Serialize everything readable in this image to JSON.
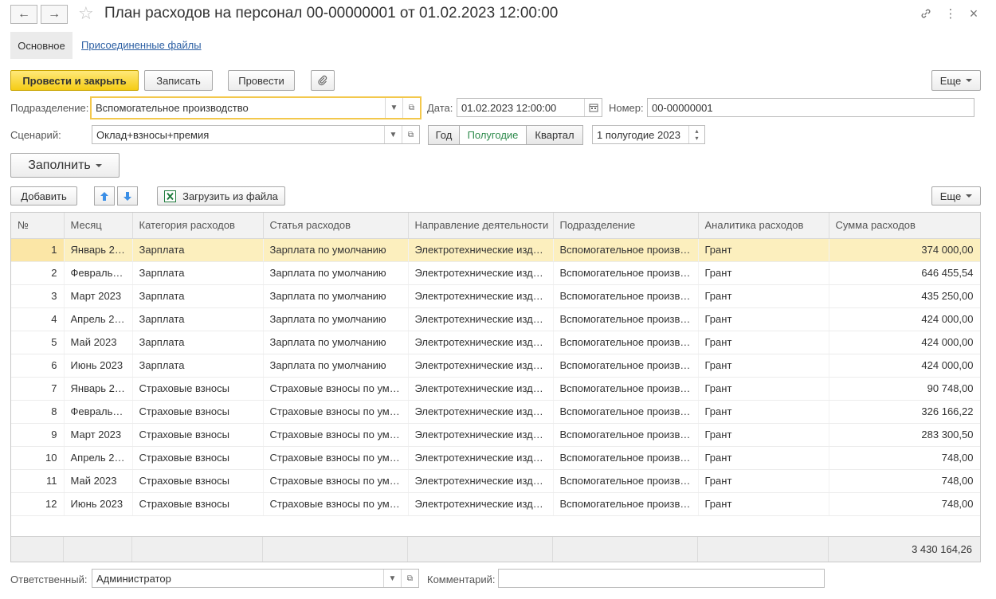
{
  "window": {
    "title": "План расходов на персонал 00-00000001 от 01.02.2023 12:00:00",
    "back_glyph": "←",
    "forward_glyph": "→",
    "star_glyph": "☆",
    "link_glyph": "🔗",
    "more_glyph": "⋮",
    "close_glyph": "×"
  },
  "tabs": {
    "main": "Основное",
    "files": "Присоединенные файлы"
  },
  "toolbar": {
    "post_close": "Провести и закрыть",
    "save": "Записать",
    "post": "Провести",
    "clip_glyph": "📎",
    "more": "Еще"
  },
  "form": {
    "department_label": "Подразделение:",
    "department_value": "Вспомогательное производство",
    "date_label": "Дата:",
    "date_value": "01.02.2023 12:00:00",
    "number_label": "Номер:",
    "number_value": "00-00000001",
    "scenario_label": "Сценарий:",
    "scenario_value": "Оклад+взносы+премия",
    "period_year": "Год",
    "period_half": "Полугодие",
    "period_quarter": "Квартал",
    "period_value": "1 полугодие 2023",
    "fill_button": "Заполнить"
  },
  "table_toolbar": {
    "add": "Добавить",
    "load_file": "Загрузить из файла",
    "more": "Еще"
  },
  "table": {
    "columns": [
      "№",
      "Месяц",
      "Категория расходов",
      "Статья расходов",
      "Направление деятельности",
      "Подразделение",
      "Аналитика расходов",
      "Сумма расходов"
    ],
    "rows": [
      [
        "1",
        "Январь 2…",
        "Зарплата",
        "Зарплата по умолчанию",
        "Электротехнические изд…",
        "Вспомогательное произв…",
        "Грант",
        "374 000,00"
      ],
      [
        "2",
        "Февраль…",
        "Зарплата",
        "Зарплата по умолчанию",
        "Электротехнические изд…",
        "Вспомогательное произв…",
        "Грант",
        "646 455,54"
      ],
      [
        "3",
        "Март 2023",
        "Зарплата",
        "Зарплата по умолчанию",
        "Электротехнические изд…",
        "Вспомогательное произв…",
        "Грант",
        "435 250,00"
      ],
      [
        "4",
        "Апрель 2…",
        "Зарплата",
        "Зарплата по умолчанию",
        "Электротехнические изд…",
        "Вспомогательное произв…",
        "Грант",
        "424 000,00"
      ],
      [
        "5",
        "Май 2023",
        "Зарплата",
        "Зарплата по умолчанию",
        "Электротехнические изд…",
        "Вспомогательное произв…",
        "Грант",
        "424 000,00"
      ],
      [
        "6",
        "Июнь 2023",
        "Зарплата",
        "Зарплата по умолчанию",
        "Электротехнические изд…",
        "Вспомогательное произв…",
        "Грант",
        "424 000,00"
      ],
      [
        "7",
        "Январь 2…",
        "Страховые взносы",
        "Страховые взносы по ум…",
        "Электротехнические изд…",
        "Вспомогательное произв…",
        "Грант",
        "90 748,00"
      ],
      [
        "8",
        "Февраль…",
        "Страховые взносы",
        "Страховые взносы по ум…",
        "Электротехнические изд…",
        "Вспомогательное произв…",
        "Грант",
        "326 166,22"
      ],
      [
        "9",
        "Март 2023",
        "Страховые взносы",
        "Страховые взносы по ум…",
        "Электротехнические изд…",
        "Вспомогательное произв…",
        "Грант",
        "283 300,50"
      ],
      [
        "10",
        "Апрель 2…",
        "Страховые взносы",
        "Страховые взносы по ум…",
        "Электротехнические изд…",
        "Вспомогательное произв…",
        "Грант",
        "748,00"
      ],
      [
        "11",
        "Май 2023",
        "Страховые взносы",
        "Страховые взносы по ум…",
        "Электротехнические изд…",
        "Вспомогательное произв…",
        "Грант",
        "748,00"
      ],
      [
        "12",
        "Июнь 2023",
        "Страховые взносы",
        "Страховые взносы по ум…",
        "Электротехнические изд…",
        "Вспомогательное произв…",
        "Грант",
        "748,00"
      ]
    ],
    "selected_row": 0,
    "total": "3 430 164,26"
  },
  "bottom": {
    "responsible_label": "Ответственный:",
    "responsible_value": "Администратор",
    "comment_label": "Комментарий:",
    "comment_value": ""
  },
  "colors": {
    "primary_button": "#f5cc15",
    "focus_border": "#f3c84c",
    "selected_row": "#fcefbe",
    "link": "#2c5fa3",
    "period_active": "#2e8b4c"
  }
}
